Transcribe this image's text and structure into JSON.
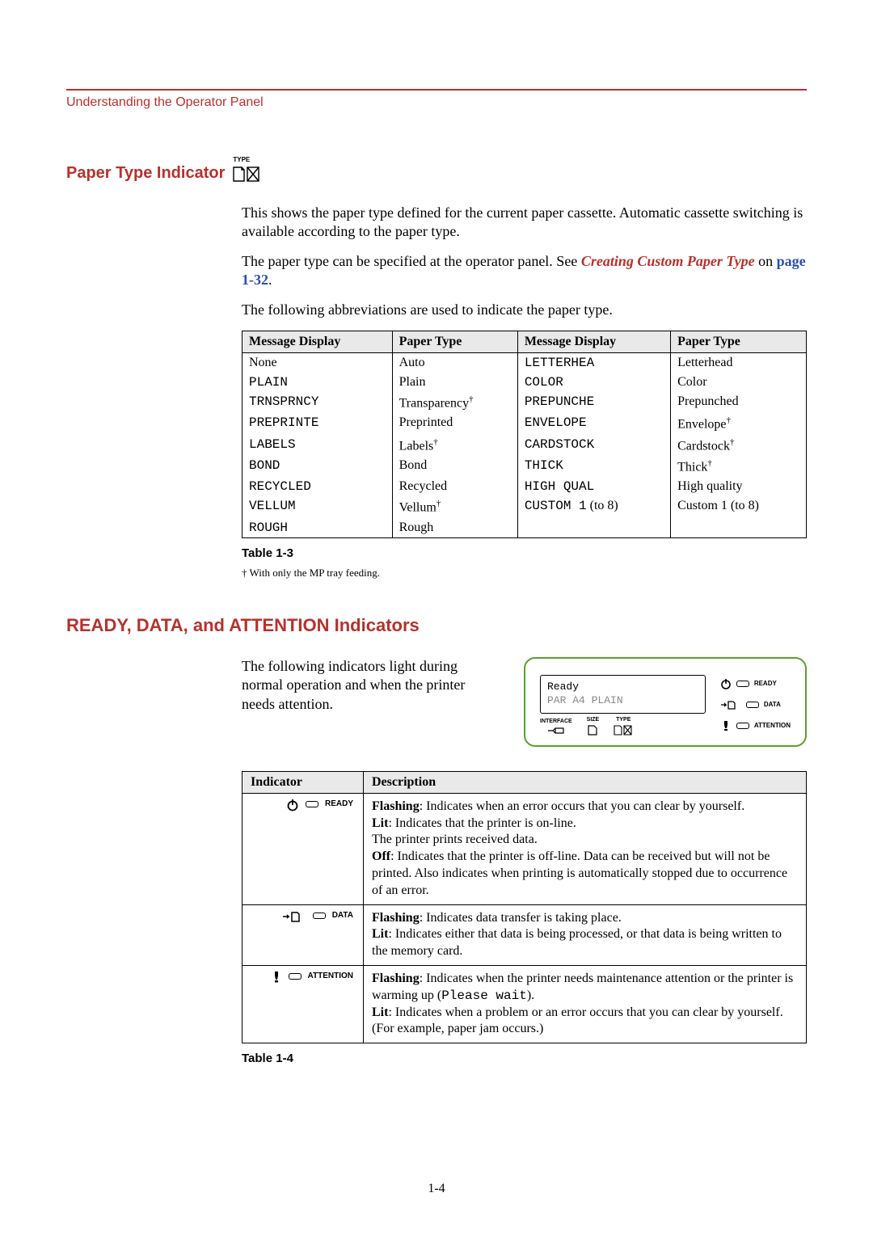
{
  "header": {
    "breadcrumb": "Understanding the Operator Panel"
  },
  "section1": {
    "title": "Paper Type Indicator",
    "icon_label": "TYPE",
    "p1": "This shows the paper type defined for the current paper cassette. Automatic cassette switching is available according to the paper type.",
    "p2_a": "The paper type can be specified at the operator panel. See ",
    "p2_link": "Creating Custom Paper Type",
    "p2_b": " on ",
    "p2_page": "page 1-32",
    "p2_c": ".",
    "p3": "The following abbreviations are used to indicate the paper type."
  },
  "table1": {
    "headers": [
      "Message Display",
      "Paper Type",
      "Message Display",
      "Paper Type"
    ],
    "rows": [
      {
        "c1": "None",
        "c1_mono": false,
        "c2": "Auto",
        "c2_dag": false,
        "c3": "LETTERHEA",
        "c4": "Letterhead",
        "c4_dag": false
      },
      {
        "c1": "PLAIN",
        "c1_mono": true,
        "c2": "Plain",
        "c2_dag": false,
        "c3": "COLOR",
        "c4": "Color",
        "c4_dag": false
      },
      {
        "c1": "TRNSPRNCY",
        "c1_mono": true,
        "c2": "Transparency",
        "c2_dag": true,
        "c3": "PREPUNCHE",
        "c4": "Prepunched",
        "c4_dag": false
      },
      {
        "c1": "PREPRINTE",
        "c1_mono": true,
        "c2": "Preprinted",
        "c2_dag": false,
        "c3": "ENVELOPE",
        "c4": "Envelope",
        "c4_dag": true
      },
      {
        "c1": "LABELS",
        "c1_mono": true,
        "c2": "Labels",
        "c2_dag": true,
        "c3": "CARDSTOCK",
        "c4": "Cardstock",
        "c4_dag": true
      },
      {
        "c1": "BOND",
        "c1_mono": true,
        "c2": "Bond",
        "c2_dag": false,
        "c3": "THICK",
        "c4": "Thick",
        "c4_dag": true
      },
      {
        "c1": "RECYCLED",
        "c1_mono": true,
        "c2": "Recycled",
        "c2_dag": false,
        "c3": "HIGH QUAL",
        "c4": "High quality",
        "c4_dag": false
      },
      {
        "c1": "VELLUM",
        "c1_mono": true,
        "c2": "Vellum",
        "c2_dag": true,
        "c3": "CUSTOM 1",
        "c3_suffix": "(to 8)",
        "c4": "Custom 1 (to 8)",
        "c4_dag": false
      },
      {
        "c1": "ROUGH",
        "c1_mono": true,
        "c2": "Rough",
        "c2_dag": false,
        "c3": "",
        "c4": "",
        "c4_dag": false
      }
    ],
    "caption": "Table 1-3",
    "footnote": "†    With only the MP tray feeding."
  },
  "section2": {
    "title": "READY, DATA, and ATTENTION Indicators",
    "para": "The following indicators light during normal operation and when the printer needs attention."
  },
  "panel": {
    "line1": "Ready",
    "line2": "PAR A4 PLAIN",
    "icons": {
      "interface": "INTERFACE",
      "size": "SIZE",
      "type": "TYPE"
    },
    "leds": {
      "ready": "READY",
      "data": "DATA",
      "attention": "ATTENTION"
    }
  },
  "table2": {
    "headers": [
      "Indicator",
      "Description"
    ],
    "rows": [
      {
        "label": "READY",
        "desc": [
          {
            "b": "Flashing",
            "t": ": Indicates when an error occurs that you can clear by yourself."
          },
          {
            "b": "Lit",
            "t": ": Indicates that the printer is on-line."
          },
          {
            "b": "",
            "t": "The printer prints received data."
          },
          {
            "b": "Off",
            "t": ": Indicates that the printer is off-line. Data can be received but will not be printed. Also indicates when printing is automatically stopped due to occurrence of an error."
          }
        ]
      },
      {
        "label": "DATA",
        "desc": [
          {
            "b": "Flashing",
            "t": ": Indicates data transfer is taking place."
          },
          {
            "b": "Lit",
            "t": ": Indicates either that data is being processed, or that data is being written to the memory card."
          }
        ]
      },
      {
        "label": "ATTENTION",
        "desc": [
          {
            "b": "Flashing",
            "t": ": Indicates when the printer needs maintenance attention or the printer is warming up (",
            "mono": "Please wait",
            "t2": ")."
          },
          {
            "b": "Lit",
            "t": ": Indicates when a problem or an error occurs that you can clear by yourself."
          },
          {
            "b": "",
            "t": "(For example, paper jam occurs.)"
          }
        ]
      }
    ],
    "caption": "Table 1-4"
  },
  "page": "1-4"
}
